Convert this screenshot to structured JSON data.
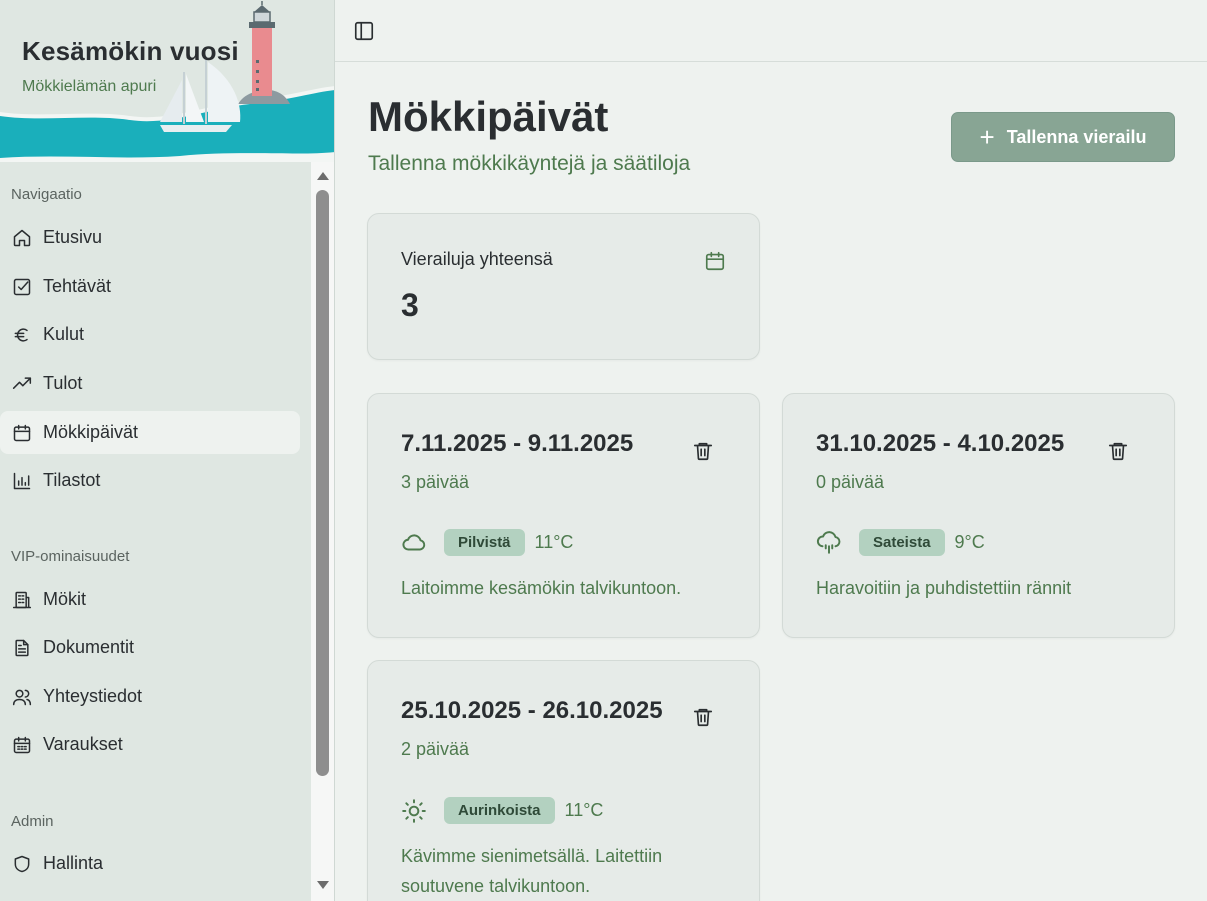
{
  "sidebar": {
    "title": "Kesämökin vuosi",
    "subtitle": "Mökkielämän apuri",
    "sections": [
      {
        "label": "Navigaatio"
      },
      {
        "label": "VIP-ominaisuudet"
      },
      {
        "label": "Admin"
      }
    ],
    "items": [
      {
        "label": "Etusivu",
        "icon": "home-icon"
      },
      {
        "label": "Tehtävät",
        "icon": "checkbox-icon"
      },
      {
        "label": "Kulut",
        "icon": "euro-icon"
      },
      {
        "label": "Tulot",
        "icon": "trending-up-icon"
      },
      {
        "label": "Mökkipäivät",
        "icon": "calendar-icon",
        "active": true
      },
      {
        "label": "Tilastot",
        "icon": "bar-chart-icon"
      },
      {
        "label": "Mökit",
        "icon": "building-icon"
      },
      {
        "label": "Dokumentit",
        "icon": "document-icon"
      },
      {
        "label": "Yhteystiedot",
        "icon": "users-icon"
      },
      {
        "label": "Varaukset",
        "icon": "calendar-days-icon"
      },
      {
        "label": "Hallinta",
        "icon": "shield-icon"
      }
    ]
  },
  "main": {
    "title": "Mökkipäivät",
    "subtitle": "Tallenna mökkikäyntejä ja säätiloja",
    "add_button": "Tallenna vierailu",
    "stat": {
      "label": "Vierailuja yhteensä",
      "value": "3"
    },
    "visits": [
      {
        "dates": "7.11.2025 - 9.11.2025",
        "days": "3 päivää",
        "weather": "Pilvistä",
        "weather_icon": "cloud-icon",
        "temp": "11°C",
        "note": "Laitoimme kesämökin talvikuntoon."
      },
      {
        "dates": "31.10.2025 - 4.10.2025",
        "days": "0 päivää",
        "weather": "Sateista",
        "weather_icon": "rain-cloud-icon",
        "temp": "9°C",
        "note": "Haravoitiin ja puhdistettiin rännit"
      },
      {
        "dates": "25.10.2025 - 26.10.2025",
        "days": "2 päivää",
        "weather": "Aurinkoista",
        "weather_icon": "sun-icon",
        "temp": "11°C",
        "note": "Kävimme sienimetsällä. Laitettiin soutuvene talvikuntoon."
      }
    ]
  },
  "colors": {
    "accent_green": "#4e7a4e",
    "button_bg": "#88a594",
    "badge_bg": "#b3d1c0",
    "sea": "#1aafbb",
    "lighthouse": "#e98b8f"
  }
}
